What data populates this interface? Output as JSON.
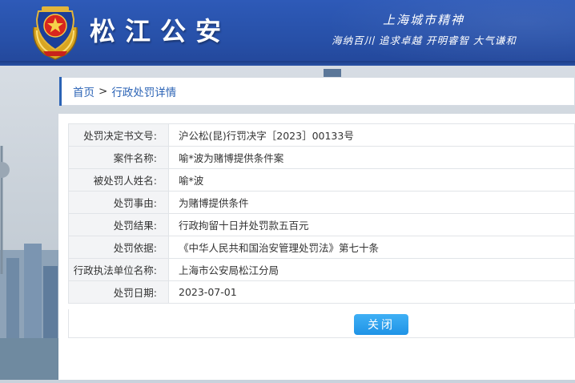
{
  "header": {
    "site_title": "松江公安",
    "slogan_line1": "上海城市精神",
    "slogan_line2": "海纳百川 追求卓越 开明睿智 大气谦和",
    "brand_color": "#2a53a6"
  },
  "breadcrumb": {
    "home": "首页",
    "separator": ">",
    "current": "行政处罚详情"
  },
  "detail": {
    "rows": [
      {
        "label": "处罚决定书文号:",
        "value": "沪公松(昆)行罚决字［2023］00133号"
      },
      {
        "label": "案件名称:",
        "value": "喻*波为赌博提供条件案"
      },
      {
        "label": "被处罚人姓名:",
        "value": "喻*波"
      },
      {
        "label": "处罚事由:",
        "value": "为赌博提供条件"
      },
      {
        "label": "处罚结果:",
        "value": "行政拘留十日并处罚款五百元"
      },
      {
        "label": "处罚依据:",
        "value": "《中华人民共和国治安管理处罚法》第七十条"
      },
      {
        "label": "行政执法单位名称:",
        "value": "上海市公安局松江分局"
      },
      {
        "label": "处罚日期:",
        "value": "2023-07-01"
      }
    ]
  },
  "actions": {
    "close_label": "关闭",
    "close_color": "#1f93e6"
  },
  "icons": {
    "emblem": "police-emblem-icon"
  }
}
